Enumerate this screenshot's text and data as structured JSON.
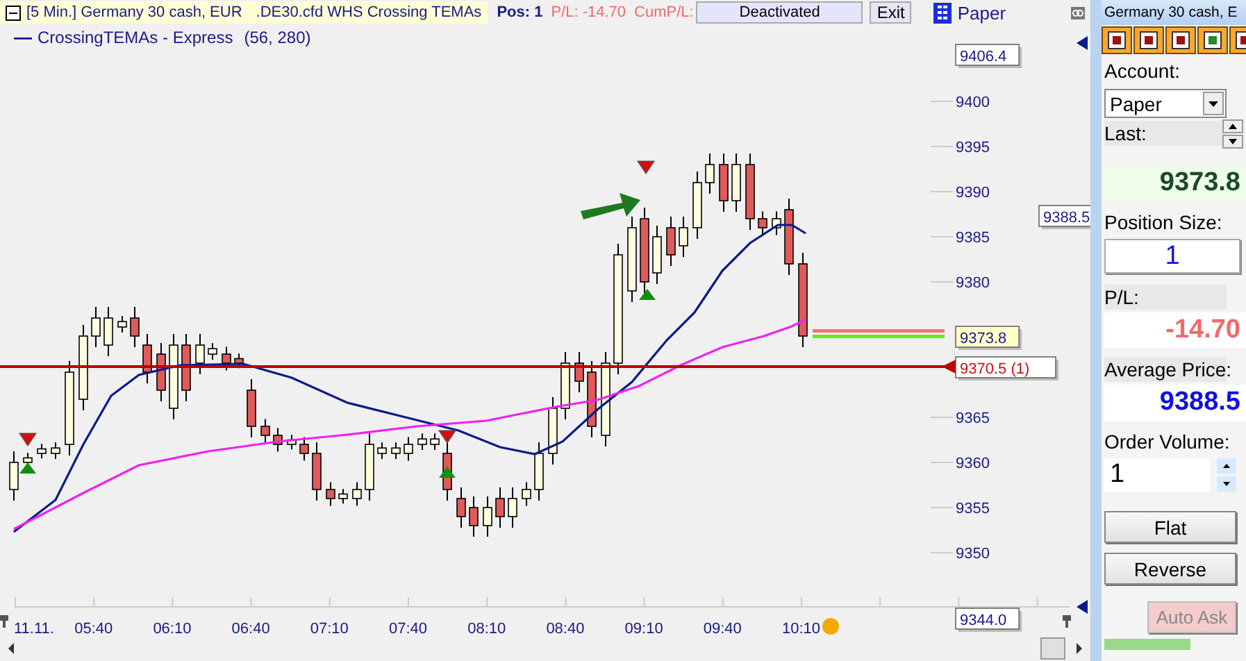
{
  "header": {
    "title": "[5 Min.] Germany 30 cash, EUR",
    "instrument": ".DE30.cfd WHS Crossing TEMAs",
    "position": "Pos: 1",
    "pl": "P/L: -14.70",
    "cum_pl_label": "CumP/L:",
    "status": "Deactivated",
    "exit_button": "Exit",
    "account": "Paper"
  },
  "legend": {
    "label": "CrossingTEMAs - Express",
    "params": "(56, 280)"
  },
  "price_axis": {
    "ticks": [
      "9400",
      "9395",
      "9390",
      "9385",
      "9380",
      "9365",
      "9360",
      "9355",
      "9350"
    ],
    "flags": [
      {
        "kind": "high",
        "label": "9406.4"
      },
      {
        "kind": "average",
        "label": "9388.5"
      },
      {
        "kind": "last",
        "label": "9373.8"
      },
      {
        "kind": "entry",
        "label": "9370.5 (1)"
      },
      {
        "kind": "low",
        "label": "9344.0"
      }
    ]
  },
  "time_axis": {
    "labels": [
      "11.11.",
      "05:40",
      "06:10",
      "06:40",
      "07:10",
      "07:40",
      "08:10",
      "08:40",
      "09:10",
      "09:40",
      "10:10"
    ]
  },
  "order_panel": {
    "title": "Germany 30 cash, E",
    "account_label": "Account:",
    "account": "Paper",
    "last_label": "Last:",
    "last": "9373.8",
    "position_size_label": "Position Size:",
    "position_size": "1",
    "pl_label": "P/L:",
    "pl": "-14.70",
    "average_price_label": "Average Price:",
    "average_price": "9388.5",
    "order_volume_label": "Order Volume:",
    "order_volume": "1",
    "buttons": [
      {
        "label": "Flat",
        "disabled": false
      },
      {
        "label": "Reverse",
        "disabled": false
      },
      {
        "label": "Auto Ask",
        "disabled": true
      }
    ]
  }
}
